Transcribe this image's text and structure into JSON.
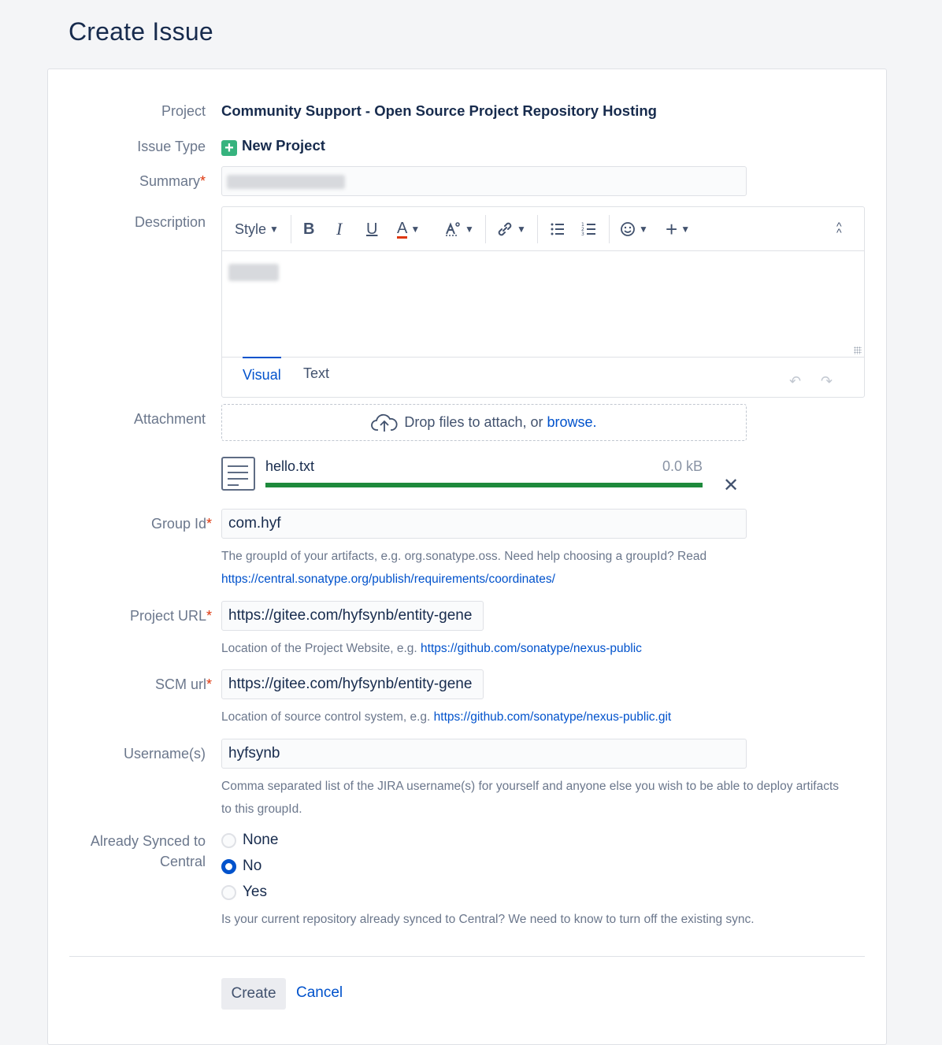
{
  "page_title": "Create Issue",
  "project": {
    "label": "Project",
    "value": "Community Support - Open Source Project Repository Hosting"
  },
  "issue_type": {
    "label": "Issue Type",
    "icon": "plus-icon",
    "value": "New Project",
    "icon_color": "#36b37e"
  },
  "summary": {
    "label": "Summary",
    "required_mark": "*"
  },
  "description": {
    "label": "Description",
    "toolbar": {
      "style": "Style",
      "bold": "B",
      "italic": "I",
      "underline": "U",
      "text_color": "A"
    },
    "tabs": {
      "visual": "Visual",
      "text": "Text"
    }
  },
  "attachment": {
    "label": "Attachment",
    "drop_text": "Drop files to attach, or",
    "browse_link": "browse.",
    "file": {
      "name": "hello.txt",
      "size": "0.0 kB",
      "progress": 1.0
    }
  },
  "group_id": {
    "label": "Group Id",
    "required_mark": "*",
    "value": "com.hyf",
    "help_text": "The groupId of your artifacts, e.g. org.sonatype.oss. Need help choosing a groupId? Read",
    "help_link": "https://central.sonatype.org/publish/requirements/coordinates/"
  },
  "project_url": {
    "label": "Project URL",
    "required_mark": "*",
    "value": "https://gitee.com/hyfsynb/entity-gene",
    "help_text": "Location of the Project Website, e.g.",
    "help_link": "https://github.com/sonatype/nexus-public"
  },
  "scm_url": {
    "label": "SCM url",
    "required_mark": "*",
    "value": "https://gitee.com/hyfsynb/entity-gene",
    "help_text": "Location of source control system, e.g.",
    "help_link": "https://github.com/sonatype/nexus-public.git"
  },
  "usernames": {
    "label": "Username(s)",
    "value": "hyfsynb",
    "help_line1": "Comma separated list of the JIRA username(s) for yourself and anyone else you wish to be able to deploy artifacts",
    "help_line2": "to this groupId."
  },
  "synced": {
    "label_line1": "Already Synced to",
    "label_line2": "Central",
    "options": [
      "None",
      "No",
      "Yes"
    ],
    "selected": "No",
    "help_text": "Is your current repository already synced to Central? We need to know to turn off the existing sync."
  },
  "buttons": {
    "create": "Create",
    "cancel": "Cancel"
  },
  "colors": {
    "link": "#0052cc",
    "required": "#de350b",
    "progress": "#1e8a3c"
  }
}
